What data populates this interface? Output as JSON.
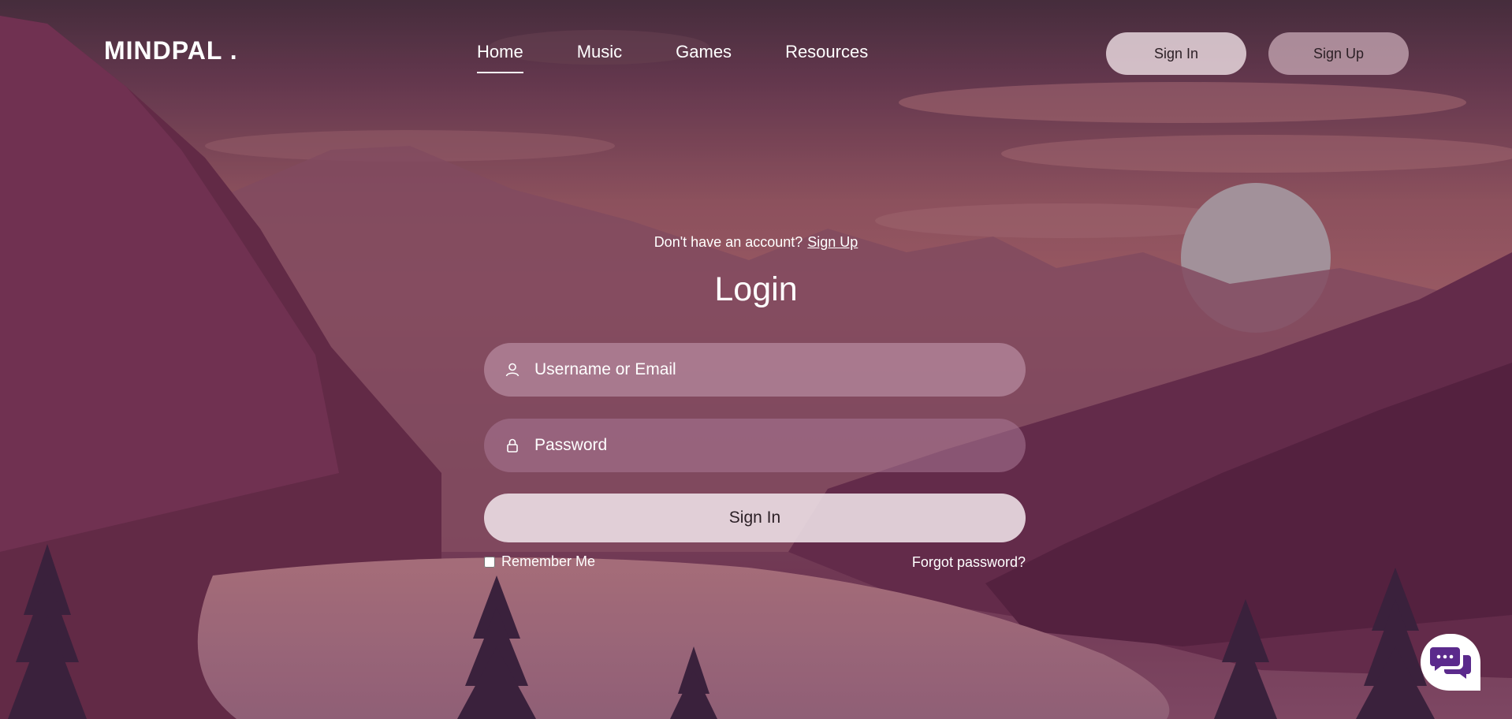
{
  "header": {
    "logo": "MINDPAL .",
    "nav": [
      {
        "label": "Home",
        "active": true
      },
      {
        "label": "Music",
        "active": false
      },
      {
        "label": "Games",
        "active": false
      },
      {
        "label": "Resources",
        "active": false
      }
    ],
    "sign_in_label": "Sign In",
    "sign_up_label": "Sign Up"
  },
  "form": {
    "account_prompt": "Don't have an account?",
    "account_link": "Sign Up",
    "title": "Login",
    "username_placeholder": "Username or Email",
    "username_icon": "user-icon",
    "password_placeholder": "Password",
    "password_icon": "lock-icon",
    "submit_label": "Sign In",
    "remember_label": "Remember Me",
    "remember_checked": false,
    "forgot_label": "Forgot password?"
  },
  "chat": {
    "icon": "chat-bubbles-icon"
  },
  "colors": {
    "accent_chat": "#5b2a8c",
    "button_light": "#ebdee4"
  }
}
